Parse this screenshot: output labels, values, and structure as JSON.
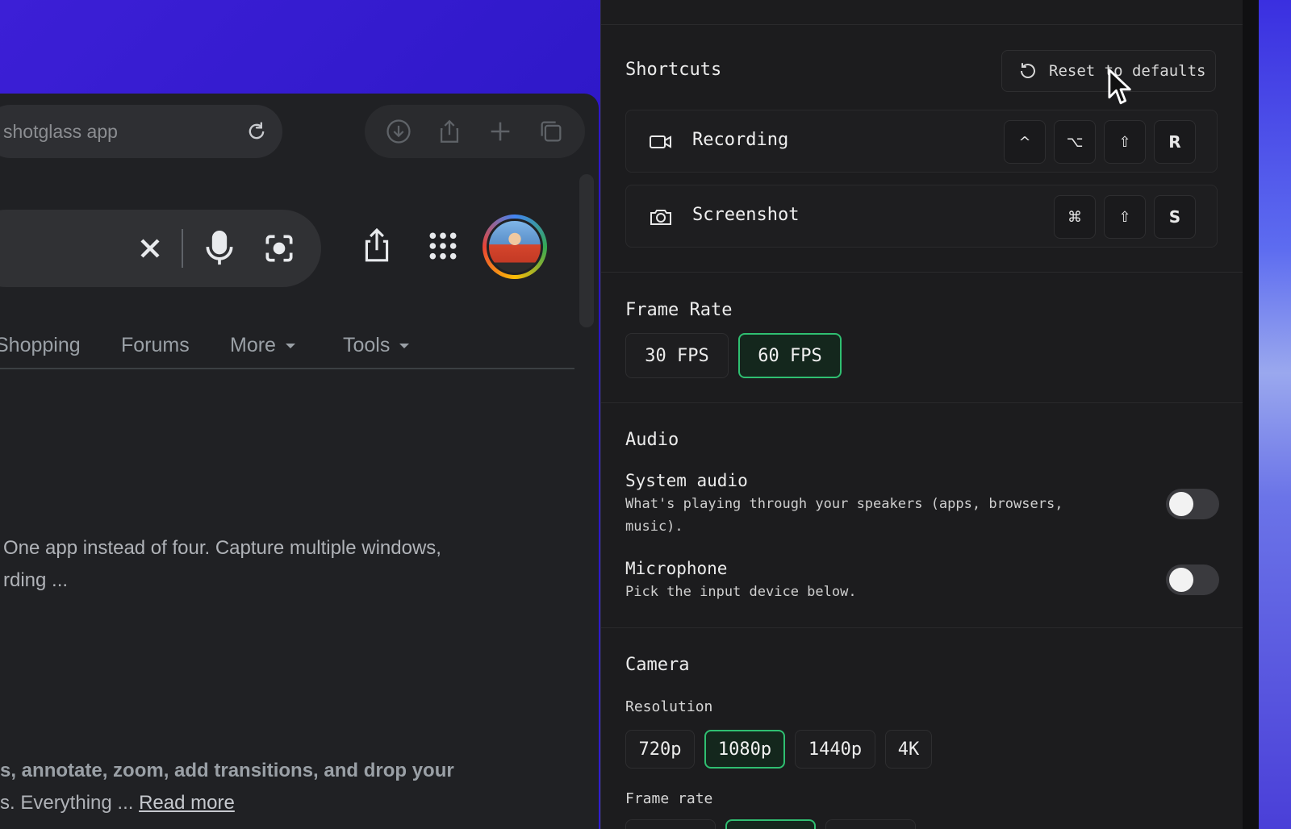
{
  "browser": {
    "address_text": "shotglass app",
    "tabs": [
      {
        "label": "Shopping"
      },
      {
        "label": "Forums"
      },
      {
        "label": "More"
      },
      {
        "label": "Tools"
      }
    ],
    "snippet1": {
      "line1": "One app instead of four. Capture multiple windows,",
      "line2": "rding ..."
    },
    "snippet2": {
      "line1": "s, annotate, zoom, add transitions, and drop your",
      "line2": "s. Everything ...",
      "read_more": "Read more"
    }
  },
  "settings": {
    "shortcuts": {
      "title": "Shortcuts",
      "reset_label": "Reset to defaults",
      "items": [
        {
          "label": "Recording",
          "icon": "video-camera-icon",
          "keys": [
            "^",
            "⌥",
            "⇧",
            "R"
          ]
        },
        {
          "label": "Screenshot",
          "icon": "camera-icon",
          "keys": [
            "⌘",
            "⇧",
            "S"
          ]
        }
      ]
    },
    "frame_rate": {
      "title": "Frame Rate",
      "options": [
        "30 FPS",
        "60 FPS"
      ],
      "selected": "60 FPS"
    },
    "audio": {
      "title": "Audio",
      "system_audio": {
        "label": "System audio",
        "description": "What's playing through your speakers (apps, browsers, music).",
        "enabled": false
      },
      "microphone": {
        "label": "Microphone",
        "description": "Pick the input device below.",
        "enabled": false
      }
    },
    "camera": {
      "title": "Camera",
      "resolution_label": "Resolution",
      "resolutions": [
        "720p",
        "1080p",
        "1440p",
        "4K"
      ],
      "selected_resolution": "1080p",
      "frame_rate_label": "Frame rate"
    }
  },
  "colors": {
    "accent_green": "#2fbf71",
    "panel_bg": "#1c1c1e",
    "desktop_bg": "#2a16c4"
  }
}
